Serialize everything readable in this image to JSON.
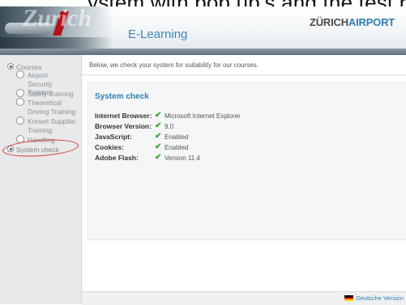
{
  "top_caption": "ystem with pop up’s and the test results are:",
  "header": {
    "logo_text": "Zurich",
    "subtitle": "E-Learning",
    "brand_part1": "ZÜRICH",
    "brand_part2": "AIRPORT"
  },
  "sidebar": {
    "items": [
      {
        "label": "Courses"
      },
      {
        "label": "Airport Security Training"
      },
      {
        "label": "Safety Training"
      },
      {
        "label": "Theoretical Driving Training"
      },
      {
        "label": "Known Supplier Training"
      },
      {
        "label": "Handling"
      },
      {
        "label": "System check"
      }
    ]
  },
  "main": {
    "intro": "Below, we check your system for suitability for our courses.",
    "panel_title": "System check",
    "checks": [
      {
        "label": "Internet Browser:",
        "value": "Microsoft Internet Explorer"
      },
      {
        "label": "Browser Version:",
        "value": "9.0"
      },
      {
        "label": "JavaScript:",
        "value": "Enabled"
      },
      {
        "label": "Cookies:",
        "value": "Enabled"
      },
      {
        "label": "Adobe Flash:",
        "value": "Version 11.4"
      }
    ],
    "check_mark": "✔"
  },
  "footer": {
    "language_link": "Deutsche Version"
  },
  "colors": {
    "accent": "#2e7fb6",
    "check": "#3aa335",
    "annotation": "#d43a2f"
  }
}
